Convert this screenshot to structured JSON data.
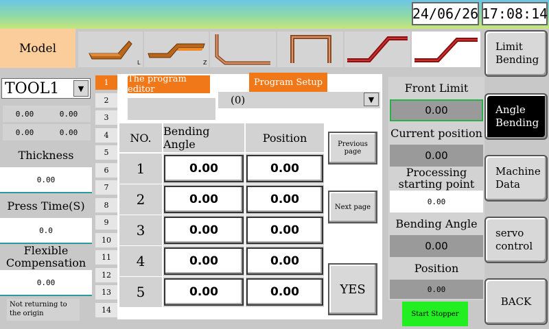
{
  "header": {
    "date": "24/06/26",
    "time": "17:08:14",
    "model_label": "Model"
  },
  "shapes": [
    {
      "name": "shape-l-bend",
      "tag": "L"
    },
    {
      "name": "shape-z-bend",
      "tag": "Z"
    },
    {
      "name": "shape-angle-bend",
      "tag": ""
    },
    {
      "name": "shape-u-channel",
      "tag": ""
    },
    {
      "name": "shape-step-bend",
      "tag": ""
    },
    {
      "name": "shape-step-bend-selected",
      "tag": ""
    }
  ],
  "tool": {
    "selected": "TOOL1",
    "values": [
      "0.00",
      "0.00",
      "0.00",
      "0.00"
    ]
  },
  "left_fields": {
    "thickness_label": "Thickness",
    "thickness_value": "0.00",
    "press_time_label": "Press Time(S)",
    "press_time_value": "0.0",
    "flex_comp_label": "Flexible Compensation",
    "flex_comp_value": "0.00",
    "origin_status": "Not returning to the origin"
  },
  "program_tabs": [
    "1",
    "2",
    "3",
    "4",
    "5",
    "6",
    "7",
    "8",
    "9",
    "10",
    "11",
    "12",
    "13",
    "14"
  ],
  "editor": {
    "program_editor_label": "The program editor",
    "program_setup_label": "Program Setup",
    "program_select_value": "(0)",
    "columns": {
      "no": "NO.",
      "angle": "Bending Angle",
      "position": "Position"
    },
    "rows": [
      {
        "no": "1",
        "angle": "0.00",
        "position": "0.00"
      },
      {
        "no": "2",
        "angle": "0.00",
        "position": "0.00"
      },
      {
        "no": "3",
        "angle": "0.00",
        "position": "0.00"
      },
      {
        "no": "4",
        "angle": "0.00",
        "position": "0.00"
      },
      {
        "no": "5",
        "angle": "0.00",
        "position": "0.00"
      }
    ],
    "prev_page": "Previous page",
    "next_page": "Next page",
    "yes": "YES"
  },
  "status": {
    "front_limit_label": "Front Limit",
    "front_limit_value": "0.00",
    "current_position_label": "Current position",
    "current_position_value": "0.00",
    "processing_start_label": "Processing starting point",
    "processing_start_value": "0.00",
    "bending_angle_label": "Bending Angle",
    "bending_angle_value": "0.00",
    "position_label": "Position",
    "position_value": "0.00",
    "start_stopper": "Start Stopper"
  },
  "nav": {
    "limit_bending": "Limit Bending",
    "angle_bending": "Angle Bending",
    "machine_data": "Machine Data",
    "servo_control": "servo control",
    "back": "BACK"
  },
  "colors": {
    "accent_orange": "#f07818",
    "active_black": "#000000",
    "start_green": "#22ee22",
    "model_peach": "#fbcd9b"
  }
}
